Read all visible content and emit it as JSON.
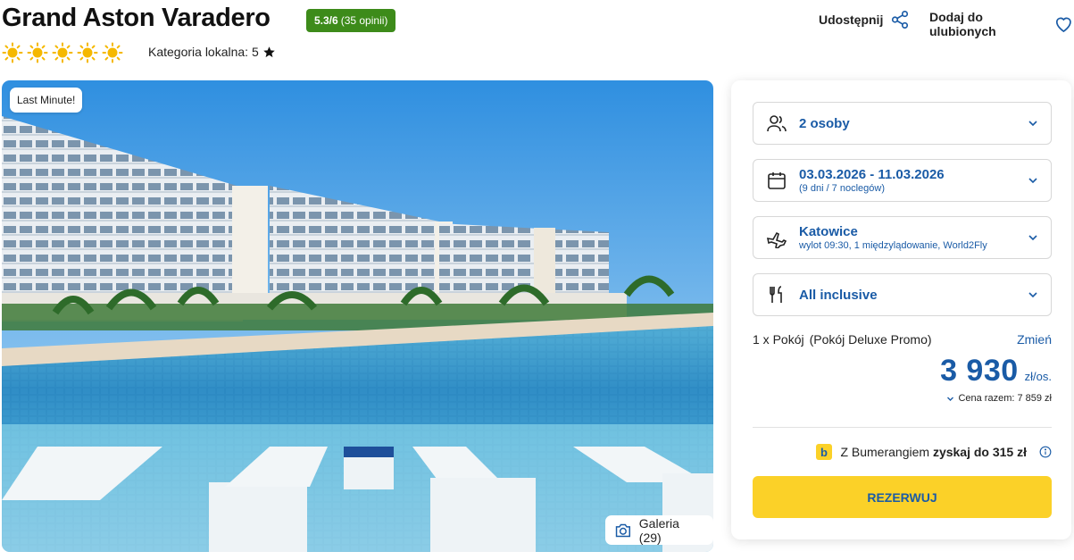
{
  "hotel": {
    "name": "Grand Aston Varadero",
    "rating_score": "5.3/6",
    "rating_count": "(35 opinii)",
    "suns_count": 5,
    "local_category_label": "Kategoria lokalna: 5",
    "sun_color": "#f5b800"
  },
  "actions": {
    "share_label": "Udostępnij",
    "favorite_label": "Dodaj do ulubionych"
  },
  "photo": {
    "badge": "Last Minute!",
    "gallery_label": "Galeria (29)"
  },
  "booking": {
    "persons": "2 osoby",
    "dates": "03.03.2026 - 11.03.2026",
    "dates_sub": "(9 dni / 7 noclegów)",
    "departure_city": "Katowice",
    "departure_sub": "wylot 09:30, 1 międzylądowanie, World2Fly",
    "board": "All inclusive",
    "room_count": "1 x Pokój",
    "room_type": "(Pokój Deluxe Promo)",
    "change_label": "Zmień",
    "price": "3 930",
    "price_unit": "zł/os.",
    "total_label": "Cena razem: 7 859 zł",
    "bumerang_prefix": "Z Bumerangiem",
    "bumerang_bold": "zyskaj do 315 zł",
    "book_label": "REZERWUJ"
  },
  "colors": {
    "brand_blue": "#1a5ba6",
    "book_yellow": "#fbd128",
    "rating_green": "#3d8b1a"
  }
}
